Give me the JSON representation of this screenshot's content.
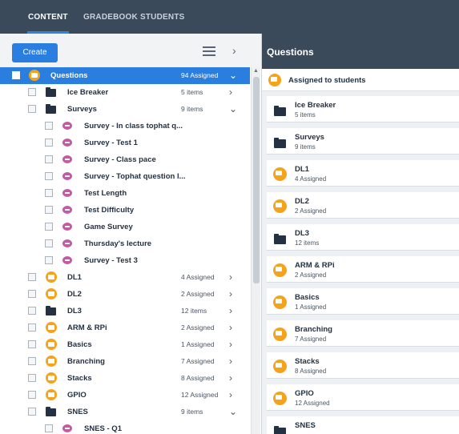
{
  "nav": {
    "tabs": [
      {
        "label": "CONTENT",
        "active": true
      },
      {
        "label": "GRADEBOOK",
        "active": false
      },
      {
        "label": "STUDENTS",
        "active": false
      }
    ]
  },
  "toolbar": {
    "create_label": "Create",
    "list_icon": "list-icon",
    "collapse_icon": "chevron-right-icon"
  },
  "tree": [
    {
      "level": 0,
      "icon": "question-set-icon",
      "label": "Questions",
      "meta": "94 Assigned",
      "chev": "⌄",
      "selected": true
    },
    {
      "level": 1,
      "icon": "folder-icon",
      "label": "Ice Breaker",
      "meta": "5 items",
      "chev": "›"
    },
    {
      "level": 1,
      "icon": "folder-icon",
      "label": "Surveys",
      "meta": "9 items",
      "chev": "⌄"
    },
    {
      "level": 2,
      "icon": "survey-icon",
      "label": "Survey - In class tophat q...",
      "meta": "",
      "chev": ""
    },
    {
      "level": 2,
      "icon": "survey-icon",
      "label": "Survey - Test 1",
      "meta": "",
      "chev": ""
    },
    {
      "level": 2,
      "icon": "survey-icon",
      "label": "Survey - Class pace",
      "meta": "",
      "chev": ""
    },
    {
      "level": 2,
      "icon": "survey-icon",
      "label": "Survey - Tophat question l...",
      "meta": "",
      "chev": ""
    },
    {
      "level": 2,
      "icon": "survey-icon",
      "label": "Test Length",
      "meta": "",
      "chev": ""
    },
    {
      "level": 2,
      "icon": "survey-icon",
      "label": "Test Difficulty",
      "meta": "",
      "chev": ""
    },
    {
      "level": 2,
      "icon": "survey-icon",
      "label": "Game Survey",
      "meta": "",
      "chev": ""
    },
    {
      "level": 2,
      "icon": "survey-icon",
      "label": "Thursday's lecture",
      "meta": "",
      "chev": ""
    },
    {
      "level": 2,
      "icon": "survey-icon",
      "label": "Survey - Test 3",
      "meta": "",
      "chev": ""
    },
    {
      "level": 1,
      "icon": "question-set-icon",
      "label": "DL1",
      "meta": "4 Assigned",
      "chev": "›"
    },
    {
      "level": 1,
      "icon": "question-set-icon",
      "label": "DL2",
      "meta": "2 Assigned",
      "chev": "›"
    },
    {
      "level": 1,
      "icon": "folder-icon",
      "label": "DL3",
      "meta": "12 items",
      "chev": "›"
    },
    {
      "level": 1,
      "icon": "question-set-icon",
      "label": "ARM & RPi",
      "meta": "2 Assigned",
      "chev": "›"
    },
    {
      "level": 1,
      "icon": "question-set-icon",
      "label": "Basics",
      "meta": "1 Assigned",
      "chev": "›"
    },
    {
      "level": 1,
      "icon": "question-set-icon",
      "label": "Branching",
      "meta": "7 Assigned",
      "chev": "›"
    },
    {
      "level": 1,
      "icon": "question-set-icon",
      "label": "Stacks",
      "meta": "8 Assigned",
      "chev": "›"
    },
    {
      "level": 1,
      "icon": "question-set-icon",
      "label": "GPIO",
      "meta": "12 Assigned",
      "chev": "›"
    },
    {
      "level": 1,
      "icon": "folder-icon",
      "label": "SNES",
      "meta": "9 items",
      "chev": "⌄"
    },
    {
      "level": 2,
      "icon": "survey-icon",
      "label": "SNES - Q1",
      "meta": "",
      "chev": ""
    }
  ],
  "right_panel": {
    "title": "Questions",
    "assigned_banner": "Assigned to students",
    "cards": [
      {
        "icon": "folder-icon",
        "title": "Ice Breaker",
        "sub": "5 items"
      },
      {
        "icon": "folder-icon",
        "title": "Surveys",
        "sub": "9 items"
      },
      {
        "icon": "question-set-icon",
        "title": "DL1",
        "sub": "4 Assigned"
      },
      {
        "icon": "question-set-icon",
        "title": "DL2",
        "sub": "2 Assigned"
      },
      {
        "icon": "folder-icon",
        "title": "DL3",
        "sub": "12 items"
      },
      {
        "icon": "question-set-icon",
        "title": "ARM & RPi",
        "sub": "2 Assigned"
      },
      {
        "icon": "question-set-icon",
        "title": "Basics",
        "sub": "1 Assigned"
      },
      {
        "icon": "question-set-icon",
        "title": "Branching",
        "sub": "7 Assigned"
      },
      {
        "icon": "question-set-icon",
        "title": "Stacks",
        "sub": "8 Assigned"
      },
      {
        "icon": "question-set-icon",
        "title": "GPIO",
        "sub": "12 Assigned"
      },
      {
        "icon": "folder-icon",
        "title": "SNES",
        "sub": ""
      }
    ]
  },
  "colors": {
    "accent": "#2a7ee0",
    "nav_bg": "#3a4a5b",
    "question_set": "#f7a31a",
    "survey": "#c25aa6",
    "folder": "#233142"
  }
}
